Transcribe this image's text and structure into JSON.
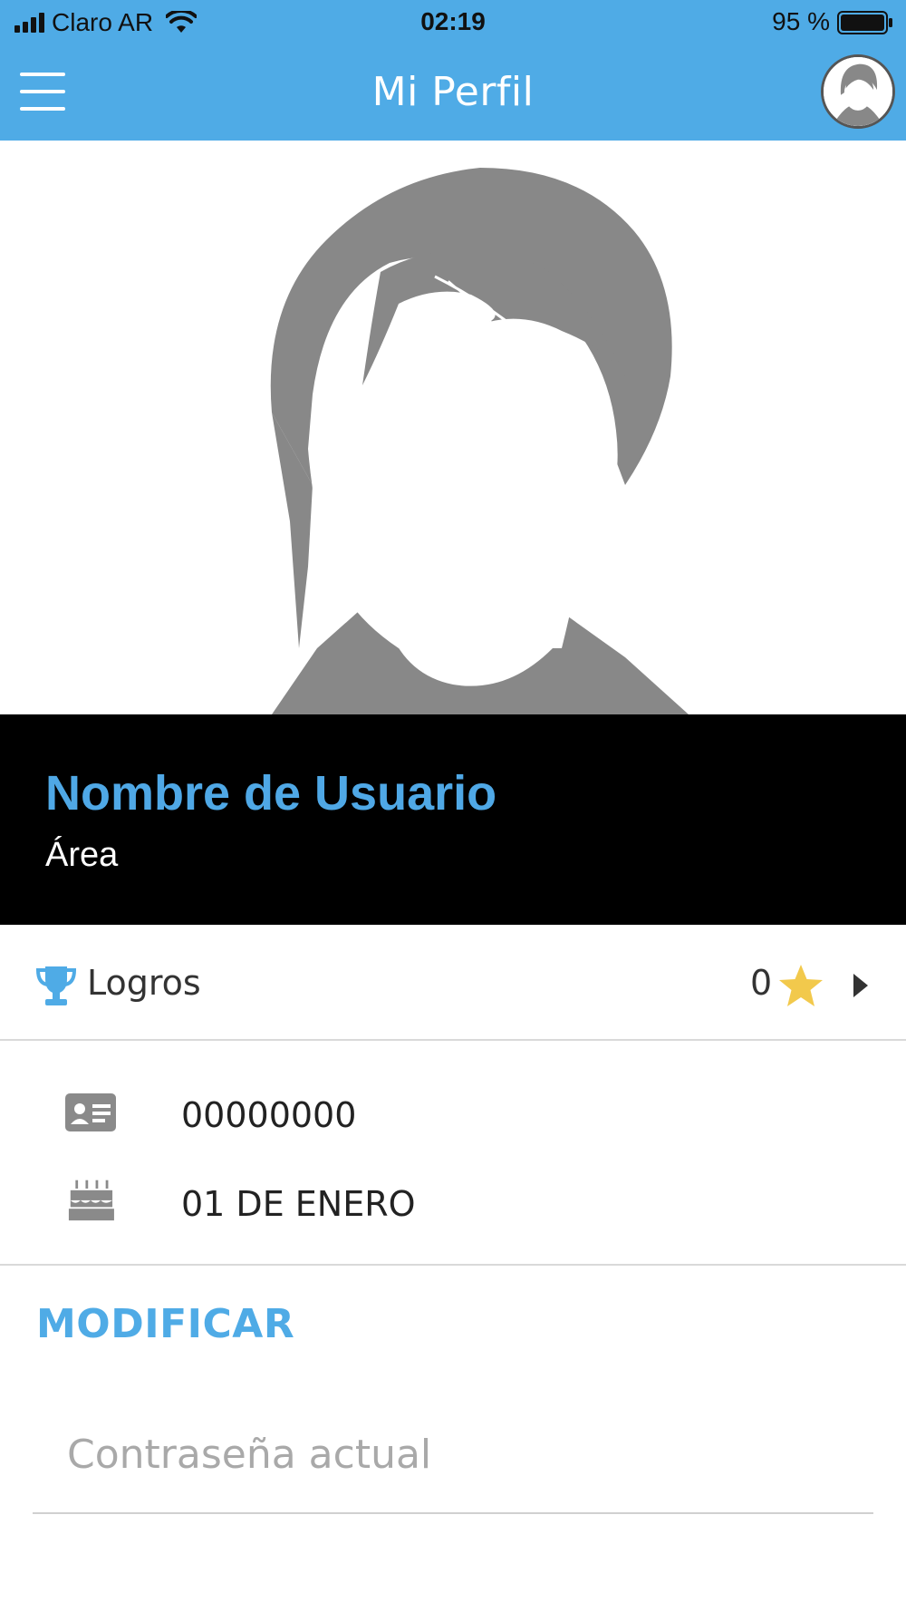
{
  "status_bar": {
    "carrier": "Claro AR",
    "time": "02:19",
    "battery": "95 %",
    "battery_level": 0.95,
    "icons": [
      "signal-icon",
      "wifi-icon",
      "battery-icon"
    ]
  },
  "header": {
    "title": "Mi Perfil",
    "menu_icon": "hamburger-menu-icon",
    "avatar_icon": "user-avatar-icon",
    "background_color": "#4fabe6"
  },
  "profile": {
    "photo": "default-profile-silhouette",
    "name": "Nombre de Usuario",
    "area": "Área",
    "name_color": "#4fa8e6"
  },
  "achievements": {
    "label": "Logros",
    "count": "0",
    "icon": "trophy-icon",
    "star_icon": "star-icon",
    "arrow_icon": "chevron-right-icon"
  },
  "details": [
    {
      "icon": "id-card-icon",
      "value": "00000000"
    },
    {
      "icon": "birthday-cake-icon",
      "value": "01 DE ENERO"
    }
  ],
  "form": {
    "section_title": "MODIFICAR",
    "current_password_placeholder": "Contraseña actual",
    "current_password_value": ""
  },
  "colors": {
    "accent": "#4fabe6",
    "star": "#f2c94c",
    "band": "#000000"
  }
}
